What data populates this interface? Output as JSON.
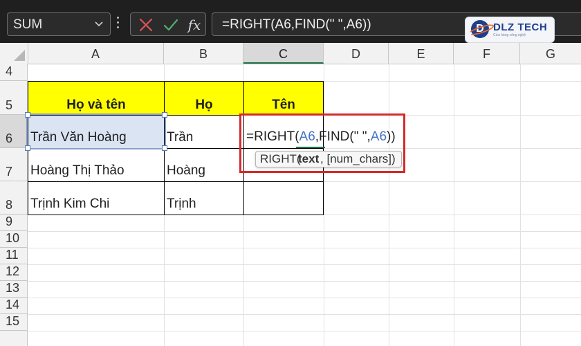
{
  "formula_bar": {
    "name_box": "SUM",
    "name_box_icon": "chevron-down-icon",
    "more_icon": "vertical-dots-icon",
    "cancel_icon": "x-icon",
    "enter_icon": "check-icon",
    "insert_function_label": "fx",
    "formula": "=RIGHT(A6,FIND(\" \",A6))"
  },
  "logo": {
    "name": "DLZ TECH",
    "tagline": "Cửa hàng công nghệ"
  },
  "columns": [
    "A",
    "B",
    "C",
    "D",
    "E",
    "F",
    "G"
  ],
  "selected_column": "C",
  "rows": [
    "4",
    "5",
    "6",
    "7",
    "8",
    "9",
    "10",
    "11",
    "12",
    "13",
    "14",
    "15"
  ],
  "selected_row": "6",
  "table": {
    "headers": [
      "Họ và tên",
      "Họ",
      "Tên"
    ],
    "rows": [
      {
        "full_name": "Trần Văn Hoàng",
        "last_name": "Trần"
      },
      {
        "full_name": "Hoàng Thị Thảo",
        "last_name": "Hoàng"
      },
      {
        "full_name": "Trịnh Kim Chi",
        "last_name": "Trịnh"
      }
    ]
  },
  "edit": {
    "prefix": "=RIGHT(",
    "ref1": "A6",
    "mid": ",FIND(\" \",",
    "ref2": "A6",
    "suffix": "))"
  },
  "tooltip": {
    "fn": "RIGHT(",
    "bold_arg": "text",
    "rest": ", [num_chars])"
  },
  "colors": {
    "header_fill": "#ffff00",
    "highlight": "#d42a2a",
    "reference": "#4472c4",
    "selection": "#1e7145"
  }
}
